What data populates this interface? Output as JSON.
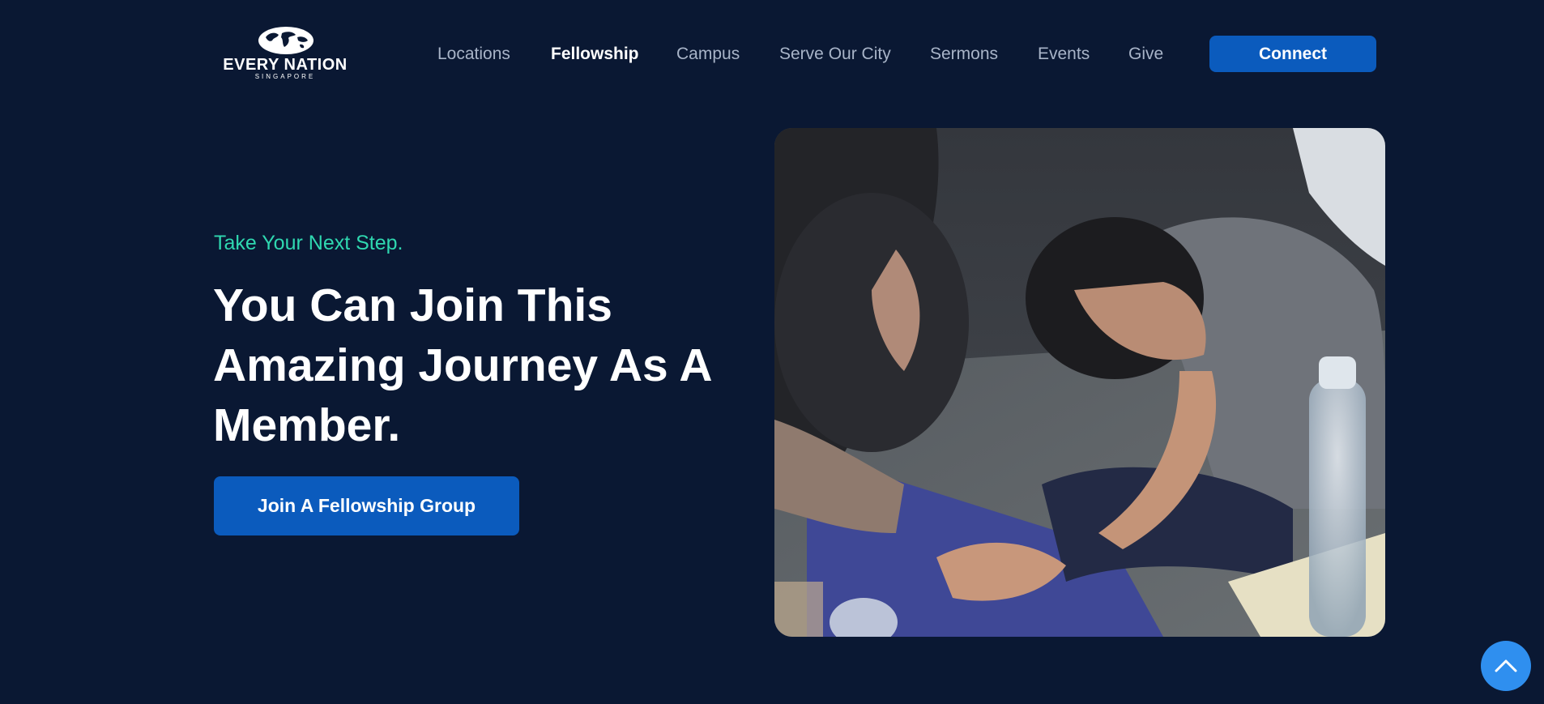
{
  "brand": {
    "name": "EVERY NATION",
    "sub": "SINGAPORE",
    "logo_icon": "globe-icon"
  },
  "nav": {
    "items": [
      {
        "label": "Locations",
        "active": false
      },
      {
        "label": "Fellowship",
        "active": true
      },
      {
        "label": "Campus",
        "active": false
      },
      {
        "label": "Serve Our City",
        "active": false
      },
      {
        "label": "Sermons",
        "active": false
      },
      {
        "label": "Events",
        "active": false
      },
      {
        "label": "Give",
        "active": false
      }
    ],
    "connect_label": "Connect"
  },
  "hero": {
    "eyebrow": "Take Your Next Step.",
    "headline": "You Can Join This Amazing Journey As A Member.",
    "cta_label": "Join A Fellowship Group"
  },
  "scroll_top": {
    "icon": "chevron-up-icon"
  },
  "colors": {
    "background": "#0a1833",
    "accent_blue": "#0b5bbd",
    "eyebrow_teal": "#2fd8b0",
    "scroll_button": "#2f8fef",
    "nav_text": "#a8b4c8"
  }
}
